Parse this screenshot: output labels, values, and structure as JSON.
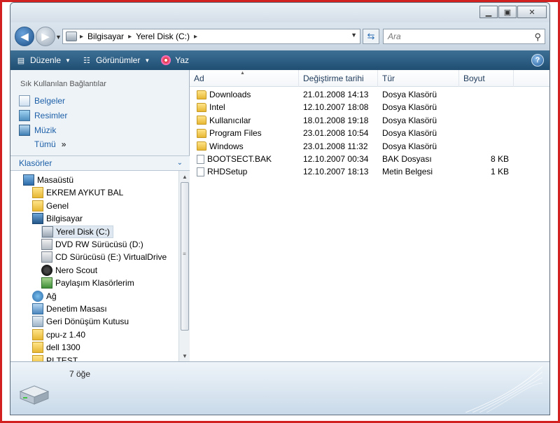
{
  "address": {
    "segments": [
      "Bilgisayar",
      "Yerel Disk (C:)"
    ],
    "search_placeholder": "Ara"
  },
  "toolbar": {
    "organize": "Düzenle",
    "views": "Görünümler",
    "burn": "Yaz"
  },
  "favorites": {
    "title": "Sık Kullanılan Bağlantılar",
    "items": [
      "Belgeler",
      "Resimler",
      "Müzik"
    ],
    "more": "Tümü"
  },
  "folders": {
    "title": "Klasörler",
    "tree": [
      {
        "label": "Masaüstü",
        "icon": "desktop-icon",
        "level": 0
      },
      {
        "label": "EKREM AYKUT BAL",
        "icon": "user-folder-icon",
        "level": 1
      },
      {
        "label": "Genel",
        "icon": "folder-icon",
        "level": 1
      },
      {
        "label": "Bilgisayar",
        "icon": "computer-icon",
        "level": 1
      },
      {
        "label": "Yerel Disk (C:)",
        "icon": "drive-icon",
        "level": 2
      },
      {
        "label": "DVD RW Sürücüsü (D:)",
        "icon": "dvd-drive-icon",
        "level": 2
      },
      {
        "label": "CD Sürücüsü (E:) VirtualDrive",
        "icon": "cd-drive-icon",
        "level": 2
      },
      {
        "label": "Nero Scout",
        "icon": "nero-icon",
        "level": 2
      },
      {
        "label": "Paylaşım Klasörlerim",
        "icon": "shared-folders-icon",
        "level": 2
      },
      {
        "label": "Ağ",
        "icon": "network-icon",
        "level": 1
      },
      {
        "label": "Denetim Masası",
        "icon": "control-panel-icon",
        "level": 1
      },
      {
        "label": "Geri Dönüşüm Kutusu",
        "icon": "recycle-bin-icon",
        "level": 1
      },
      {
        "label": "cpu-z 1.40",
        "icon": "folder-icon",
        "level": 1
      },
      {
        "label": "dell 1300",
        "icon": "folder-icon",
        "level": 1
      },
      {
        "label": "PI TEST",
        "icon": "folder-icon",
        "level": 1
      }
    ]
  },
  "columns": [
    "Ad",
    "Değiştirme tarihi",
    "Tür",
    "Boyut"
  ],
  "files": [
    {
      "name": "Downloads",
      "date": "21.01.2008 14:13",
      "type": "Dosya Klasörü",
      "size": "",
      "icon": "folder-icon"
    },
    {
      "name": "Intel",
      "date": "12.10.2007 18:08",
      "type": "Dosya Klasörü",
      "size": "",
      "icon": "folder-icon"
    },
    {
      "name": "Kullanıcılar",
      "date": "18.01.2008 19:18",
      "type": "Dosya Klasörü",
      "size": "",
      "icon": "folder-icon"
    },
    {
      "name": "Program Files",
      "date": "23.01.2008 10:54",
      "type": "Dosya Klasörü",
      "size": "",
      "icon": "folder-icon"
    },
    {
      "name": "Windows",
      "date": "23.01.2008 11:32",
      "type": "Dosya Klasörü",
      "size": "",
      "icon": "folder-icon"
    },
    {
      "name": "BOOTSECT.BAK",
      "date": "12.10.2007 00:34",
      "type": "BAK Dosyası",
      "size": "8 KB",
      "icon": "file-icon"
    },
    {
      "name": "RHDSetup",
      "date": "12.10.2007 18:13",
      "type": "Metin Belgesi",
      "size": "1 KB",
      "icon": "file-icon"
    }
  ],
  "status": {
    "count": "7 öğe"
  }
}
